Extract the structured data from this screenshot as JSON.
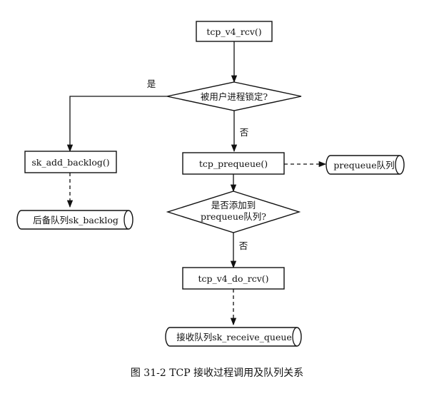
{
  "diagram": {
    "nodes": {
      "tcp_v4_rcv": "tcp_v4_rcv()",
      "locked_decision": "被用户进程锁定?",
      "sk_add_backlog": "sk_add_backlog()",
      "backlog_queue": "后备队列sk_backlog",
      "tcp_prequeue": "tcp_prequeue()",
      "prequeue_queue": "prequeue队列",
      "added_decision_line1": "是否添加到",
      "added_decision_line2": "prequeue队列?",
      "tcp_v4_do_rcv": "tcp_v4_do_rcv()",
      "receive_queue": "接收队列sk_receive_queue"
    },
    "labels": {
      "yes": "是",
      "no_1": "否",
      "no_2": "否"
    }
  },
  "caption": "图 31-2 TCP 接收过程调用及队列关系"
}
